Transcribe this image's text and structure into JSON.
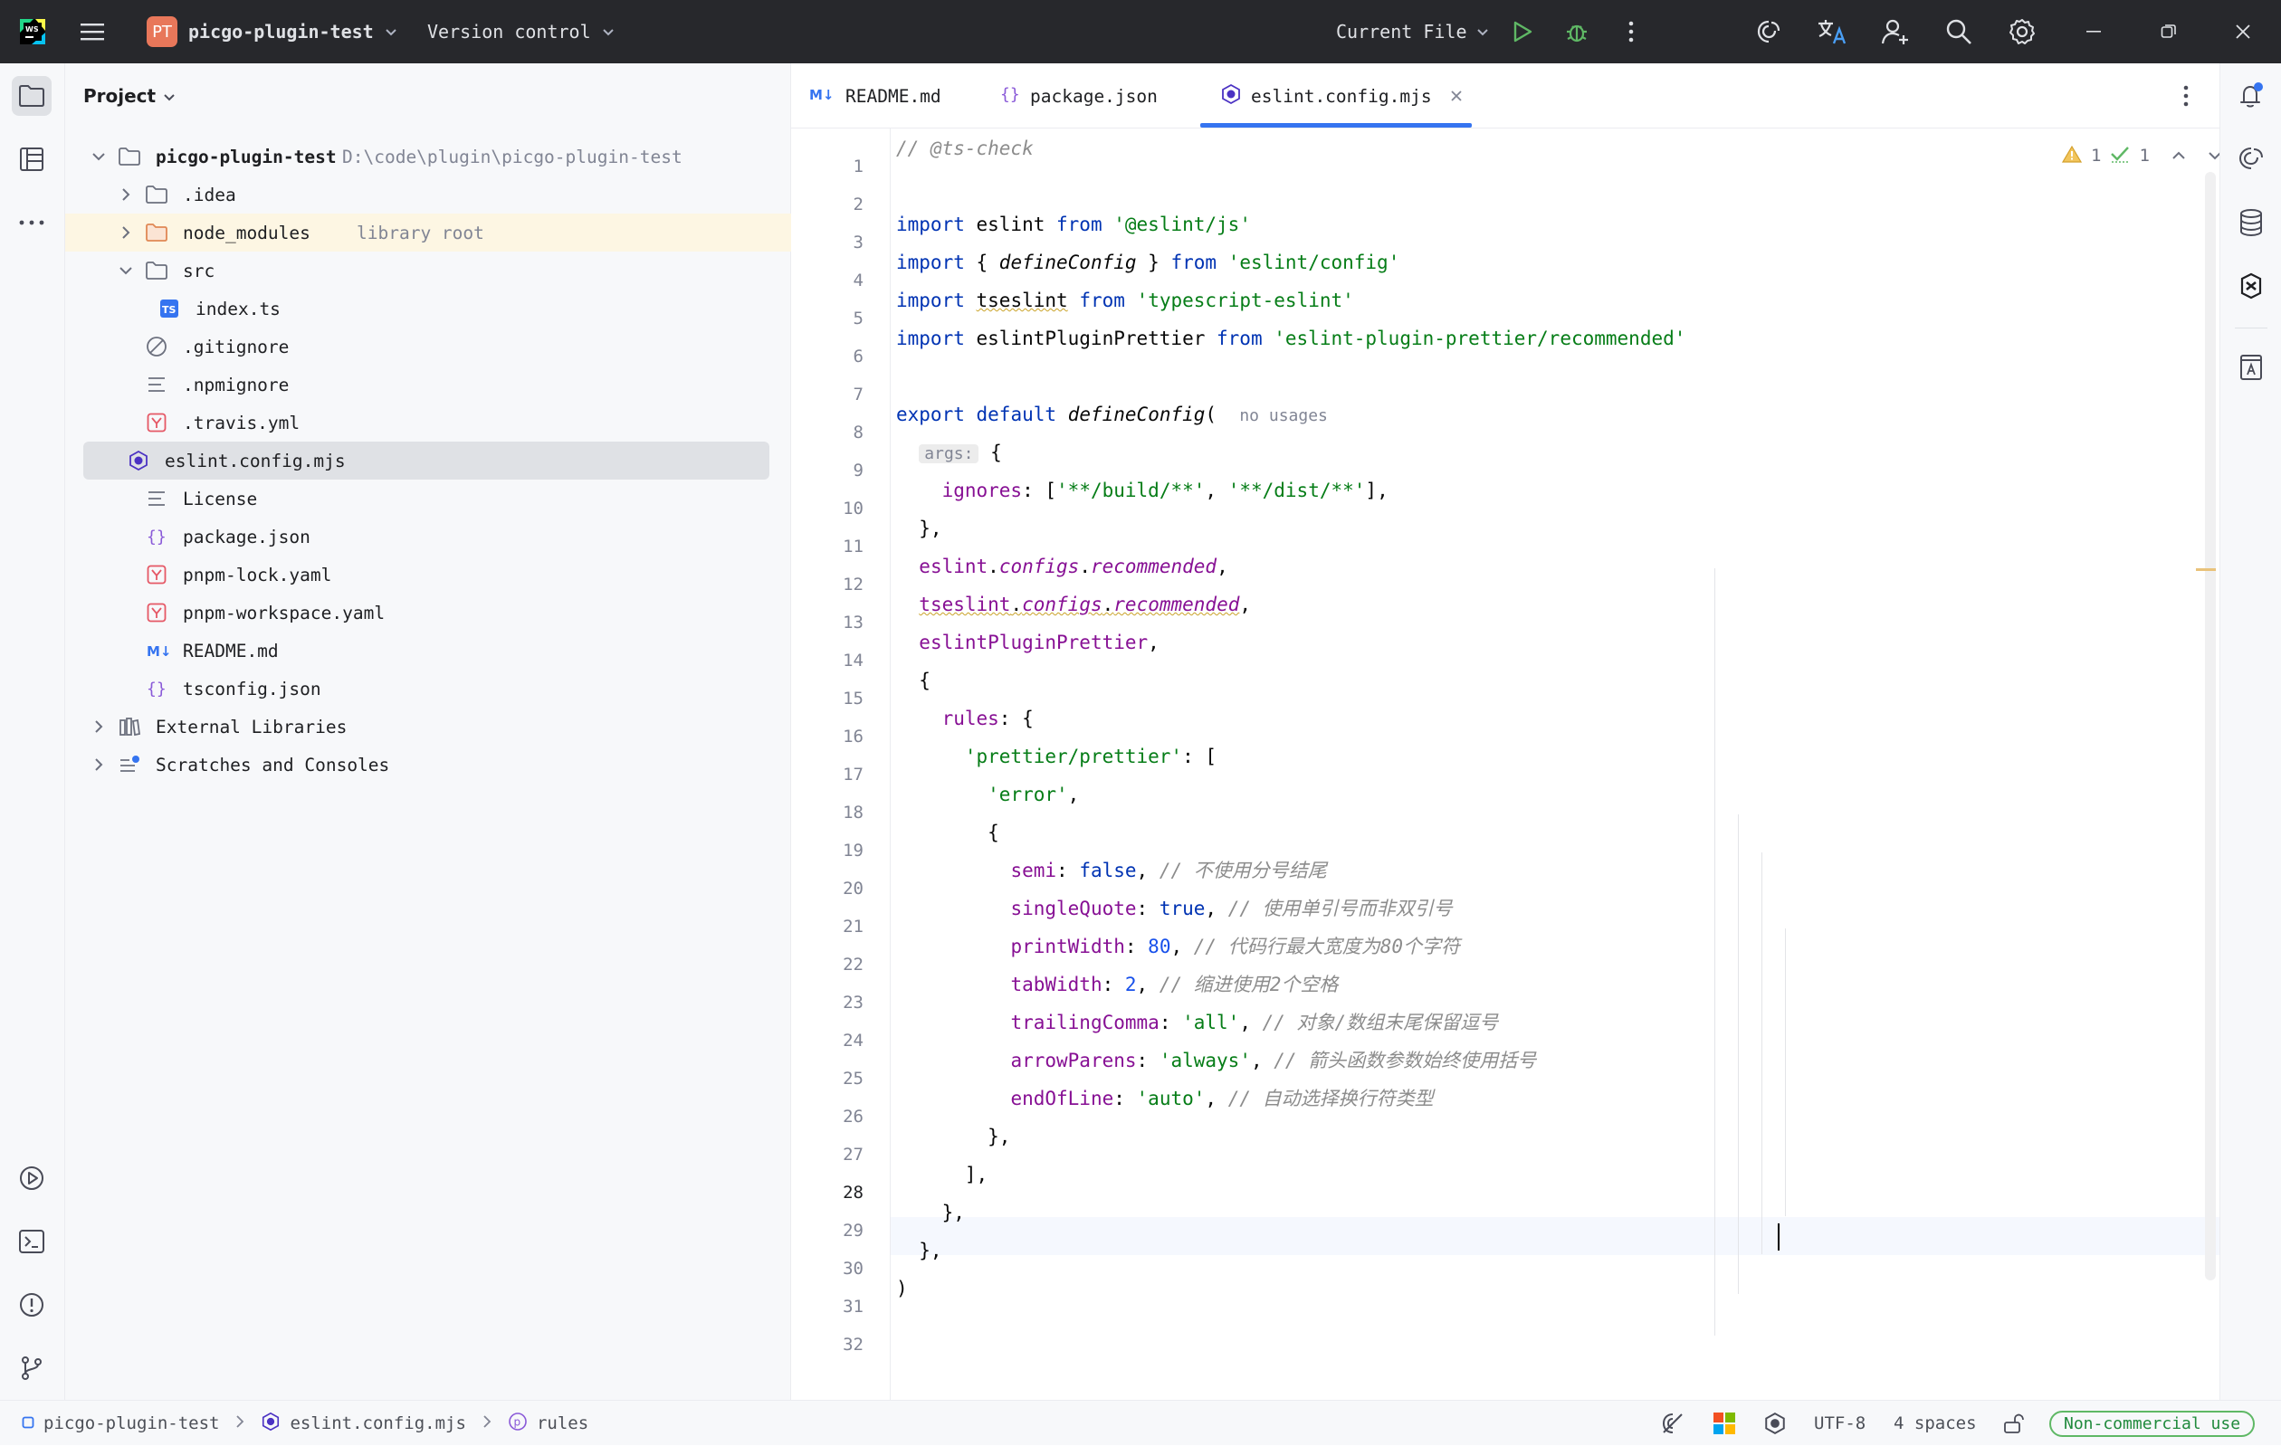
{
  "titlebar": {
    "project_badge": "PT",
    "project_name": "picgo-plugin-test",
    "vcs": "Version control",
    "run_config": "Current File"
  },
  "project": {
    "title": "Project",
    "root_name": "picgo-plugin-test",
    "root_path": "D:\\code\\plugin\\picgo-plugin-test",
    "items": [
      {
        "label": ".idea",
        "hint": ""
      },
      {
        "label": "node_modules",
        "hint": "library root"
      },
      {
        "label": "src",
        "hint": ""
      },
      {
        "label": "index.ts",
        "hint": ""
      },
      {
        "label": ".gitignore",
        "hint": ""
      },
      {
        "label": ".npmignore",
        "hint": ""
      },
      {
        "label": ".travis.yml",
        "hint": ""
      },
      {
        "label": "eslint.config.mjs",
        "hint": ""
      },
      {
        "label": "License",
        "hint": ""
      },
      {
        "label": "package.json",
        "hint": ""
      },
      {
        "label": "pnpm-lock.yaml",
        "hint": ""
      },
      {
        "label": "pnpm-workspace.yaml",
        "hint": ""
      },
      {
        "label": "README.md",
        "hint": ""
      },
      {
        "label": "tsconfig.json",
        "hint": ""
      },
      {
        "label": "External Libraries",
        "hint": ""
      },
      {
        "label": "Scratches and Consoles",
        "hint": ""
      }
    ]
  },
  "tabs": [
    {
      "label": "README.md"
    },
    {
      "label": "package.json"
    },
    {
      "label": "eslint.config.mjs"
    }
  ],
  "inspections": {
    "warnings": "1",
    "checks": "1"
  },
  "editor": {
    "line_numbers": [
      "1",
      "2",
      "3",
      "4",
      "5",
      "6",
      "7",
      "8",
      "9",
      "10",
      "11",
      "12",
      "13",
      "14",
      "15",
      "16",
      "17",
      "18",
      "19",
      "20",
      "21",
      "22",
      "23",
      "24",
      "25",
      "26",
      "27",
      "28",
      "29",
      "30",
      "31",
      "32"
    ],
    "lines": [
      [
        {
          "t": "// @ts-check",
          "c": "cmt"
        }
      ],
      [],
      [
        {
          "t": "import",
          "c": "kw"
        },
        {
          "t": " eslint "
        },
        {
          "t": "from",
          "c": "kw"
        },
        {
          "t": " "
        },
        {
          "t": "'@eslint/js'",
          "c": "str"
        }
      ],
      [
        {
          "t": "import",
          "c": "kw"
        },
        {
          "t": " { "
        },
        {
          "t": "defineConfig",
          "c": "fn"
        },
        {
          "t": " } "
        },
        {
          "t": "from",
          "c": "kw"
        },
        {
          "t": " "
        },
        {
          "t": "'eslint/config'",
          "c": "str"
        }
      ],
      [
        {
          "t": "import",
          "c": "kw"
        },
        {
          "t": " "
        },
        {
          "t": "tseslint",
          "c": "uline"
        },
        {
          "t": " "
        },
        {
          "t": "from",
          "c": "kw"
        },
        {
          "t": " "
        },
        {
          "t": "'typescript-eslint'",
          "c": "str"
        }
      ],
      [
        {
          "t": "import",
          "c": "kw"
        },
        {
          "t": " eslintPluginPrettier "
        },
        {
          "t": "from",
          "c": "kw"
        },
        {
          "t": " "
        },
        {
          "t": "'eslint-plugin-prettier/recommended'",
          "c": "str"
        }
      ],
      [],
      [
        {
          "t": "export",
          "c": "kw"
        },
        {
          "t": " "
        },
        {
          "t": "default",
          "c": "kw"
        },
        {
          "t": " "
        },
        {
          "t": "defineConfig",
          "c": "fn"
        },
        {
          "t": "(  "
        },
        {
          "t": "no usages",
          "c": "inlay"
        }
      ],
      [
        {
          "t": "  "
        },
        {
          "t": "args:",
          "c": "inlaybox"
        },
        {
          "t": " {"
        }
      ],
      [
        {
          "t": "    "
        },
        {
          "t": "ignores",
          "c": "prop"
        },
        {
          "t": ": ["
        },
        {
          "t": "'**/build/**'",
          "c": "str"
        },
        {
          "t": ", "
        },
        {
          "t": "'**/dist/**'",
          "c": "str"
        },
        {
          "t": "],"
        }
      ],
      [
        {
          "t": "  },"
        }
      ],
      [
        {
          "t": "  "
        },
        {
          "t": "eslint",
          "c": "prop"
        },
        {
          "t": "."
        },
        {
          "t": "configs",
          "c": "propi"
        },
        {
          "t": "."
        },
        {
          "t": "recommended",
          "c": "propi"
        },
        {
          "t": ","
        }
      ],
      [
        {
          "t": "  "
        },
        {
          "t": "tseslint",
          "c": "prop uline"
        },
        {
          "t": ".",
          "c": "uline"
        },
        {
          "t": "configs",
          "c": "propi uline"
        },
        {
          "t": ".",
          "c": "uline"
        },
        {
          "t": "recommended",
          "c": "propi uline"
        },
        {
          "t": ","
        }
      ],
      [
        {
          "t": "  "
        },
        {
          "t": "eslintPluginPrettier",
          "c": "prop"
        },
        {
          "t": ","
        }
      ],
      [
        {
          "t": "  {"
        }
      ],
      [
        {
          "t": "    "
        },
        {
          "t": "rules",
          "c": "prop"
        },
        {
          "t": ": {"
        }
      ],
      [
        {
          "t": "      "
        },
        {
          "t": "'prettier/prettier'",
          "c": "str"
        },
        {
          "t": ": ["
        }
      ],
      [
        {
          "t": "        "
        },
        {
          "t": "'error'",
          "c": "str"
        },
        {
          "t": ","
        }
      ],
      [
        {
          "t": "        {"
        }
      ],
      [
        {
          "t": "          "
        },
        {
          "t": "semi",
          "c": "prop"
        },
        {
          "t": ": "
        },
        {
          "t": "false",
          "c": "kw"
        },
        {
          "t": ", "
        },
        {
          "t": "// 不使用分号结尾",
          "c": "cmt"
        }
      ],
      [
        {
          "t": "          "
        },
        {
          "t": "singleQuote",
          "c": "prop"
        },
        {
          "t": ": "
        },
        {
          "t": "true",
          "c": "kw"
        },
        {
          "t": ", "
        },
        {
          "t": "// 使用单引号而非双引号",
          "c": "cmt"
        }
      ],
      [
        {
          "t": "          "
        },
        {
          "t": "printWidth",
          "c": "prop"
        },
        {
          "t": ": "
        },
        {
          "t": "80",
          "c": "num"
        },
        {
          "t": ", "
        },
        {
          "t": "// 代码行最大宽度为80个字符",
          "c": "cmt"
        }
      ],
      [
        {
          "t": "          "
        },
        {
          "t": "tabWidth",
          "c": "prop"
        },
        {
          "t": ": "
        },
        {
          "t": "2",
          "c": "num"
        },
        {
          "t": ", "
        },
        {
          "t": "// 缩进使用2个空格",
          "c": "cmt"
        }
      ],
      [
        {
          "t": "          "
        },
        {
          "t": "trailingComma",
          "c": "prop"
        },
        {
          "t": ": "
        },
        {
          "t": "'all'",
          "c": "str"
        },
        {
          "t": ", "
        },
        {
          "t": "// 对象/数组末尾保留逗号",
          "c": "cmt"
        }
      ],
      [
        {
          "t": "          "
        },
        {
          "t": "arrowParens",
          "c": "prop"
        },
        {
          "t": ": "
        },
        {
          "t": "'always'",
          "c": "str"
        },
        {
          "t": ", "
        },
        {
          "t": "// 箭头函数参数始终使用括号",
          "c": "cmt"
        }
      ],
      [
        {
          "t": "          "
        },
        {
          "t": "endOfLine",
          "c": "prop"
        },
        {
          "t": ": "
        },
        {
          "t": "'auto'",
          "c": "str"
        },
        {
          "t": ", "
        },
        {
          "t": "// 自动选择换行符类型",
          "c": "cmt"
        }
      ],
      [
        {
          "t": "        },"
        }
      ],
      [
        {
          "t": "      ],"
        }
      ],
      [
        {
          "t": "    },"
        }
      ],
      [
        {
          "t": "  },"
        }
      ],
      [
        {
          "t": ")"
        }
      ],
      []
    ]
  },
  "breadcrumb": [
    "picgo-plugin-test",
    "eslint.config.mjs",
    "rules"
  ],
  "status": {
    "encoding": "UTF-8",
    "indent": "4 spaces",
    "license": "Non-commercial use"
  },
  "colors": {
    "accent": "#3574f0",
    "titlebar": "#27282c",
    "run": "#5fb865"
  }
}
